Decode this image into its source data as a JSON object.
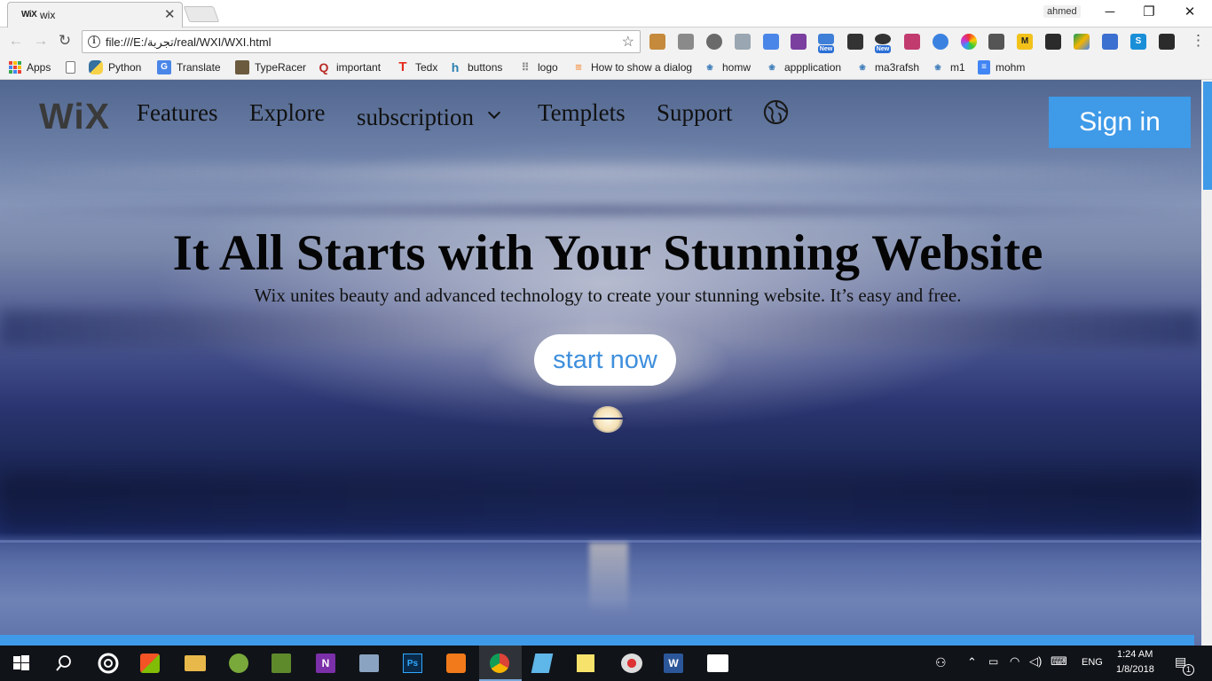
{
  "browser": {
    "tab": {
      "favicon_text": "WiX",
      "title": "wix"
    },
    "user": "ahmed",
    "window_controls": {
      "minimize": "─",
      "restore": "❐",
      "close": "✕"
    },
    "address": "file:///E:/تجربة/real/WXI/WXI.html",
    "ext_labels": {
      "m": "M",
      "s": "S",
      "new1": "New",
      "new2": "New"
    }
  },
  "bookmarks": [
    {
      "label": "Apps",
      "icon": "apps-grid-icon"
    },
    {
      "label": "",
      "icon": "page-icon"
    },
    {
      "label": "Python",
      "icon": "python-icon"
    },
    {
      "label": "Translate",
      "icon": "translate-icon"
    },
    {
      "label": "TypeRacer",
      "icon": "typeracer-icon"
    },
    {
      "label": "important",
      "icon": "quora-icon"
    },
    {
      "label": "Tedx",
      "icon": "tedx-icon"
    },
    {
      "label": "buttons",
      "icon": "buttons-icon"
    },
    {
      "label": "logo",
      "icon": "logo-icon"
    },
    {
      "label": "How to show a dialog",
      "icon": "stackoverflow-icon"
    },
    {
      "label": "homw",
      "icon": "uwc-icon"
    },
    {
      "label": "appplication",
      "icon": "uwc-icon"
    },
    {
      "label": "ma3rafsh",
      "icon": "uwc-icon"
    },
    {
      "label": "m1",
      "icon": "uwc-icon"
    },
    {
      "label": "mohm",
      "icon": "docs-icon"
    }
  ],
  "site": {
    "logo": "WiX",
    "nav": {
      "features": "Features",
      "explore": "Explore",
      "subscription": "subscription",
      "templets": "Templets",
      "support": "Support"
    },
    "signin": "Sign in",
    "hero_title": "It All Starts with Your Stunning Website",
    "hero_subtitle": "Wix unites beauty and advanced technology to create your stunning website. It’s easy and free.",
    "cta": "start now",
    "colors": {
      "accent": "#3f9ae8",
      "cta_text": "#3f8fdc"
    }
  },
  "taskbar": {
    "language": "ENG",
    "time": "1:24 AM",
    "date": "1/8/2018",
    "notification_count": "1"
  }
}
